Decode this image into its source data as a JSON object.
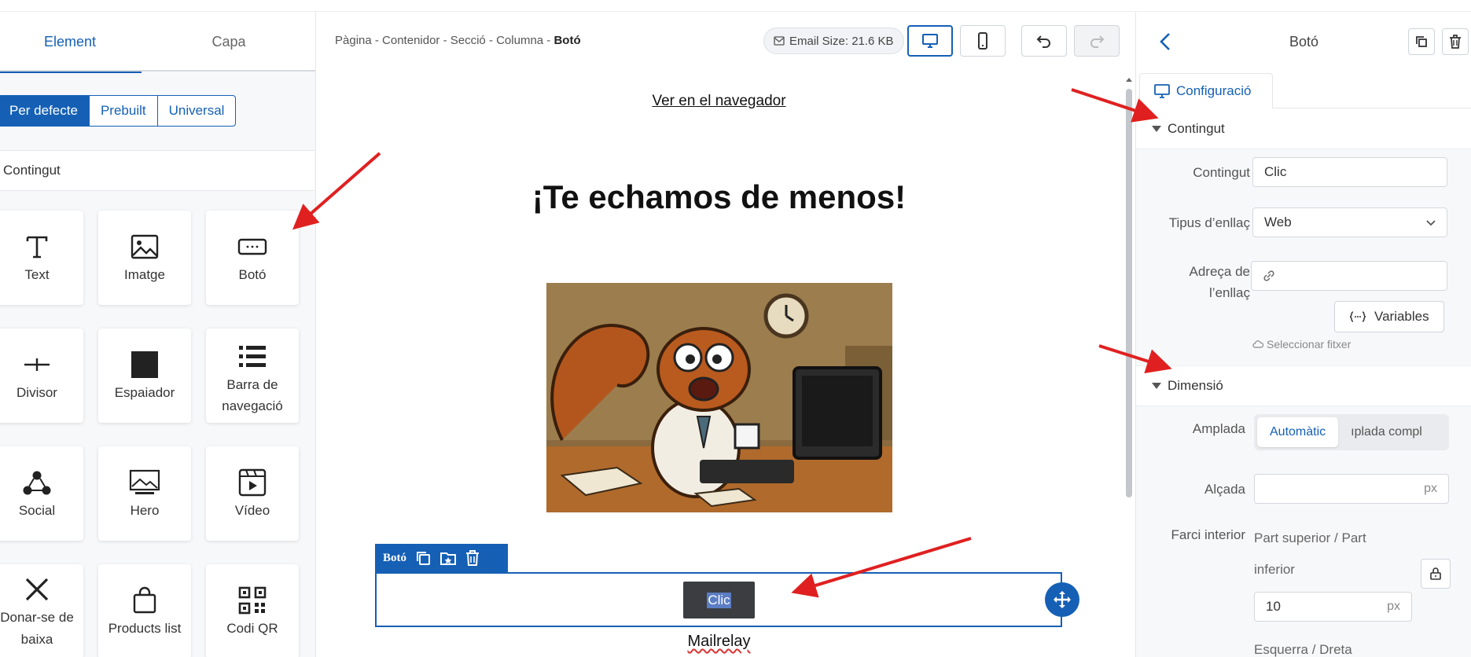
{
  "left_panel": {
    "tabs": [
      {
        "label": "Element"
      },
      {
        "label": "Capa"
      }
    ],
    "filters": [
      {
        "label": "Per defecte"
      },
      {
        "label": "Prebuilt"
      },
      {
        "label": "Universal"
      }
    ],
    "section_title": "Contingut",
    "blocks": [
      {
        "label": "Text",
        "icon": "text-icon"
      },
      {
        "label": "Imatge",
        "icon": "image-icon"
      },
      {
        "label": "Botó",
        "icon": "button-icon"
      },
      {
        "label": "Divisor",
        "icon": "divider-icon"
      },
      {
        "label": "Espaiador",
        "icon": "spacer-icon"
      },
      {
        "label": "Barra de navegació",
        "icon": "navbar-icon"
      },
      {
        "label": "Social",
        "icon": "social-icon"
      },
      {
        "label": "Hero",
        "icon": "hero-icon"
      },
      {
        "label": "Vídeo",
        "icon": "video-icon"
      },
      {
        "label": "Donar-se de baixa",
        "icon": "unsubscribe-icon"
      },
      {
        "label": "Products list",
        "icon": "shopping-bag-icon"
      },
      {
        "label": "Codi QR",
        "icon": "qr-code-icon"
      }
    ]
  },
  "toolbar": {
    "breadcrumb": "Pàgina - Contenidor - Secció - Columna - ",
    "breadcrumb_current": "Botó",
    "email_size": "Email Size: 21.6 KB"
  },
  "canvas": {
    "browser_link": "Ver en el navegador",
    "headline": "¡Te echamos de menos!",
    "image_alt": "Cartoon squirrel at a computer",
    "selection_label": "Botó",
    "button_text": "Clic",
    "footer_text": "Mailrelay"
  },
  "right_panel": {
    "title": "Botó",
    "tab": "Configuració",
    "group_content": "Contingut",
    "content_label": "Contingut",
    "content_value": "Clic",
    "link_type_label": "Tipus d’enllaç",
    "link_type_value": "Web",
    "link_address_label_1": "Adreça de",
    "link_address_label_2": "l’enllaç",
    "variables_button": "Variables",
    "select_file": "Seleccionar fitxer",
    "group_dimension": "Dimensió",
    "width_label": "Amplada",
    "width_options": [
      {
        "label": "Automàtic"
      },
      {
        "label": "ıplada compl"
      }
    ],
    "height_label": "Alçada",
    "unit": "px",
    "padding_label": "Farci interior",
    "padding_sub_1": "Part superior / Part",
    "padding_sub_2": "inferior",
    "padding_value": "10",
    "padding_sides": "Esquerra / Dreta"
  },
  "colors": {
    "accent": "#1560b5",
    "arrow": "#e02020",
    "button_bg": "#3b3d40"
  }
}
